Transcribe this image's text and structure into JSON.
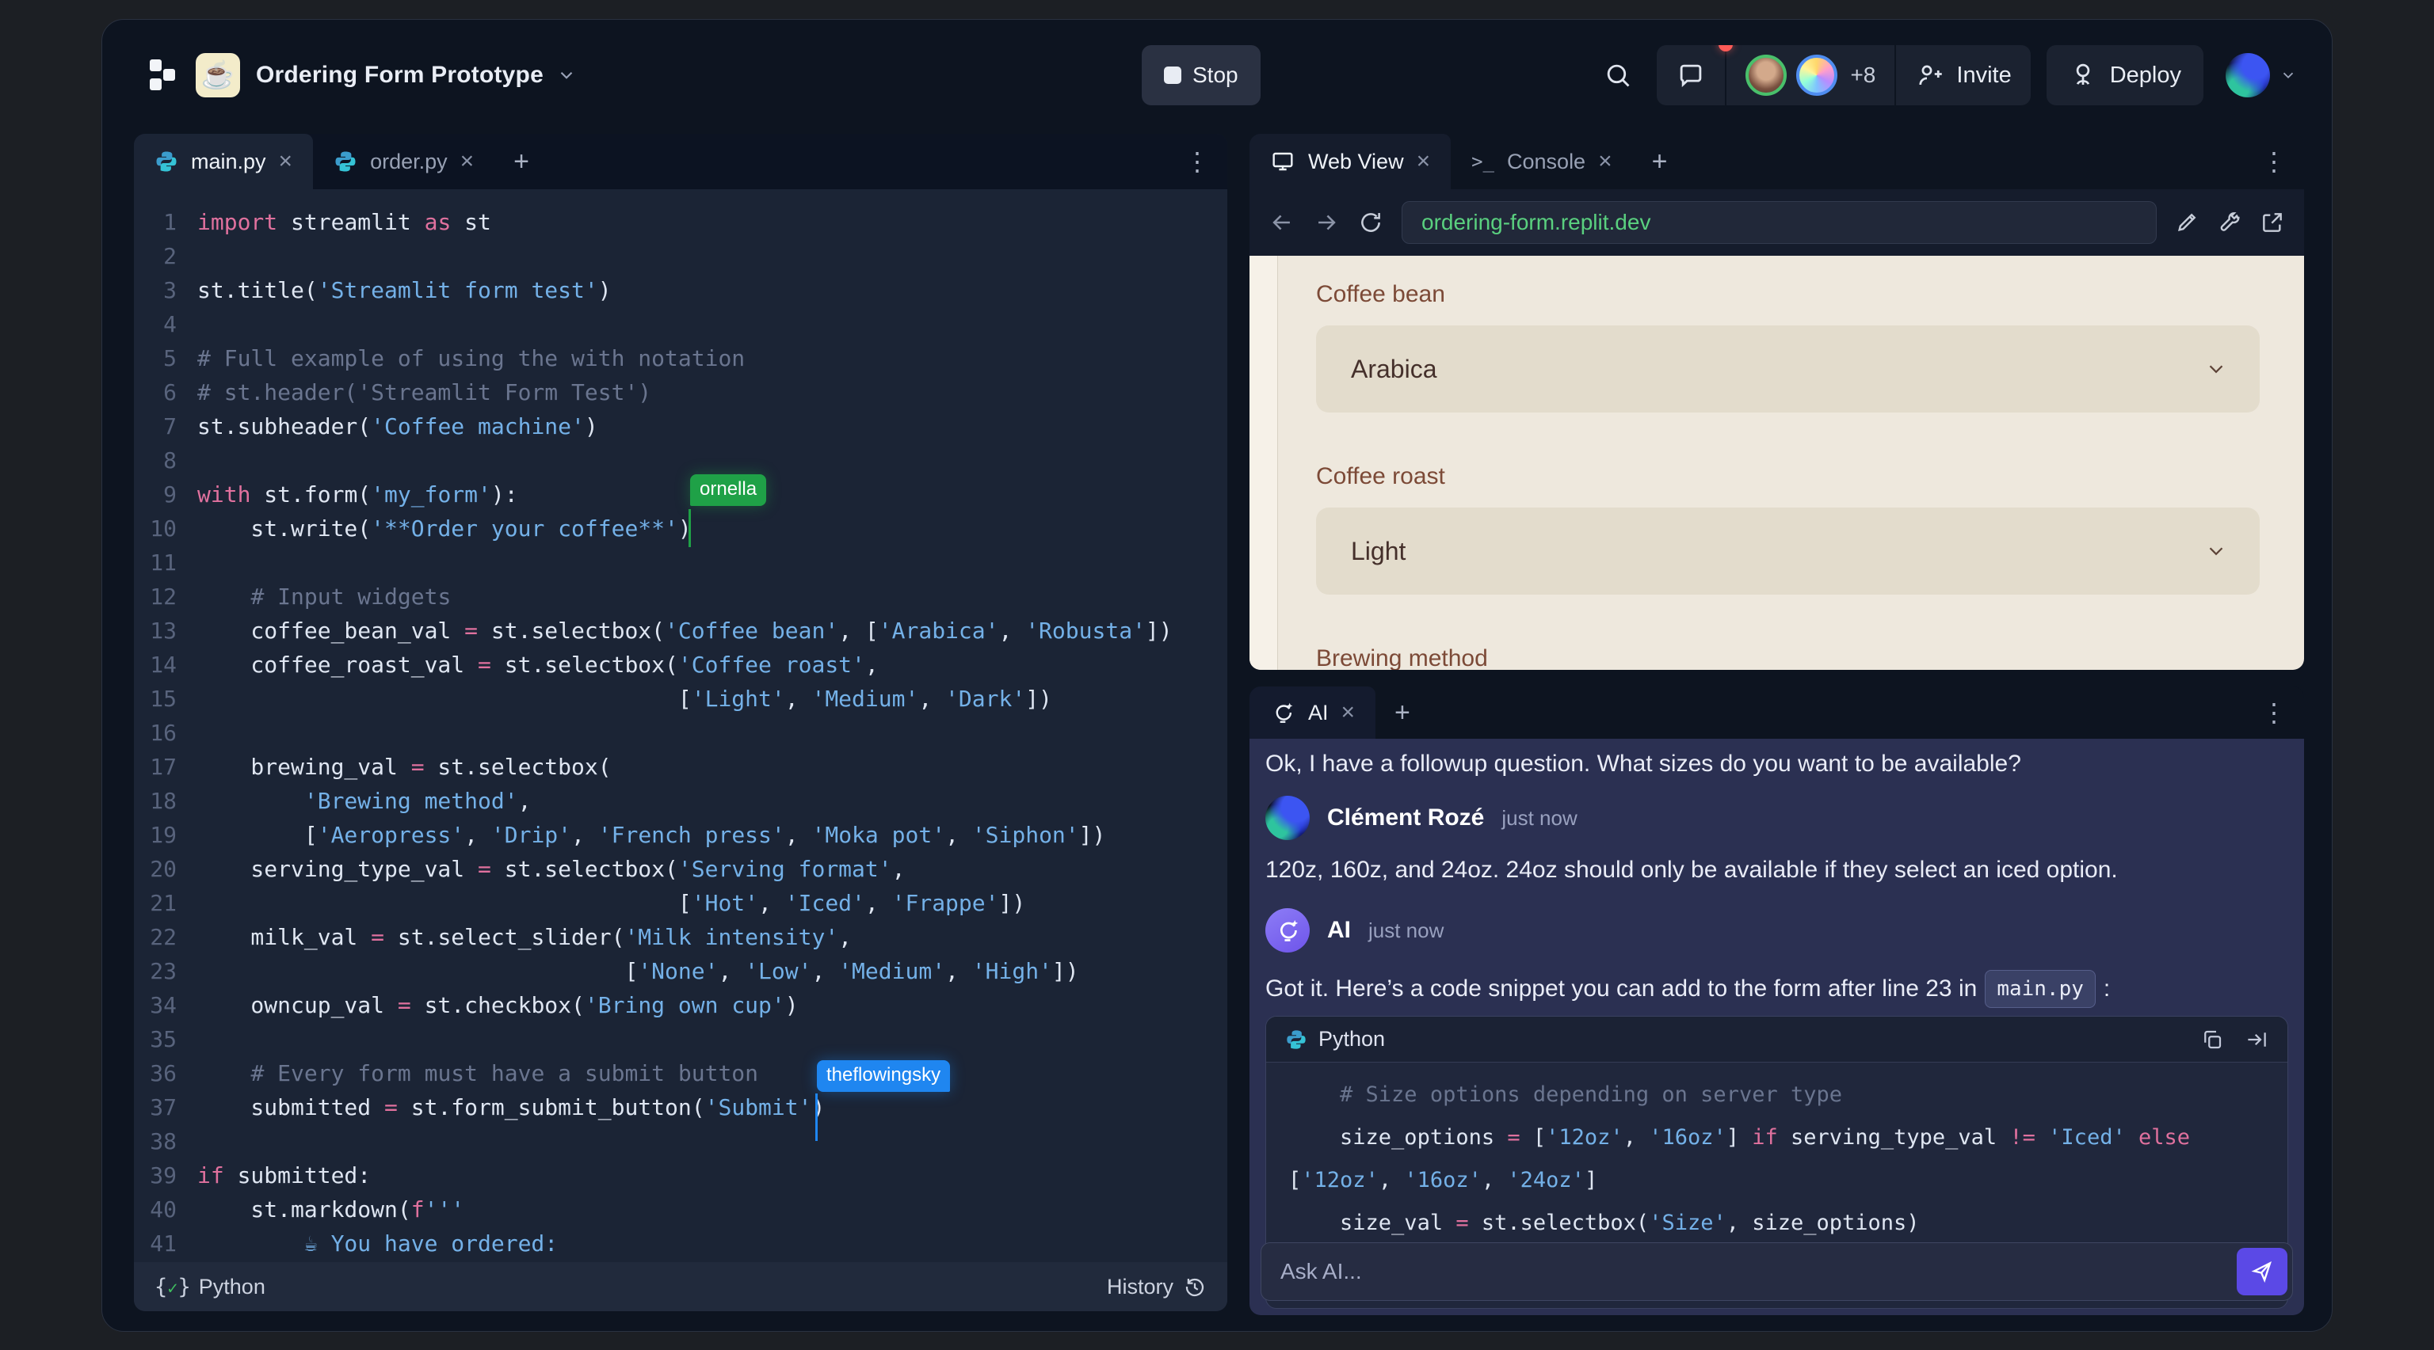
{
  "colors": {
    "window_bg": "#0d1420",
    "editor_bg": "#1b2435",
    "chat_bg": "#2b3052",
    "webview_bg": "#eee8dd",
    "url_green": "#5ad07f",
    "send_purple": "#5b49e6",
    "cursor_green": "#1fa147",
    "cursor_blue": "#1f86f0",
    "notification_red": "#ff5b57"
  },
  "icons": {
    "close": "×",
    "plus": "+",
    "kebab": "⋮",
    "console_glyph": ">_",
    "brace_open": "{",
    "check": "✓",
    "brace_close": "}",
    "coffee": "☕"
  },
  "topbar": {
    "title": "Ordering Form Prototype",
    "stop": "Stop",
    "members_more": "+8",
    "invite": "Invite",
    "deploy": "Deploy"
  },
  "editor": {
    "tabs": [
      {
        "label": "main.py"
      },
      {
        "label": "order.py"
      }
    ],
    "status": {
      "lang": "Python",
      "history": "History"
    },
    "cursors": {
      "green": "ornella",
      "blue": "theflowingsky"
    },
    "lines": [
      {
        "n": "1",
        "t": [
          [
            "k",
            "import"
          ],
          [
            "p",
            " streamlit "
          ],
          [
            "k",
            "as"
          ],
          [
            "p",
            " st"
          ]
        ]
      },
      {
        "n": "2",
        "t": []
      },
      {
        "n": "3",
        "t": [
          [
            "p",
            "st.title("
          ],
          [
            "s",
            "'Streamlit form test'"
          ],
          [
            "p",
            ")"
          ]
        ]
      },
      {
        "n": "4",
        "t": []
      },
      {
        "n": "5",
        "t": [
          [
            "c",
            "# Full example of using the with notation"
          ]
        ]
      },
      {
        "n": "6",
        "t": [
          [
            "c",
            "# st.header('Streamlit Form Test')"
          ]
        ]
      },
      {
        "n": "7",
        "t": [
          [
            "p",
            "st.subheader("
          ],
          [
            "s",
            "'Coffee machine'"
          ],
          [
            "p",
            ")"
          ]
        ]
      },
      {
        "n": "8",
        "t": []
      },
      {
        "n": "9",
        "t": [
          [
            "k",
            "with"
          ],
          [
            "p",
            " st.form("
          ],
          [
            "s",
            "'my_form'"
          ],
          [
            "p",
            "):"
          ]
        ]
      },
      {
        "n": "10",
        "t": [
          [
            "p",
            "    st.write("
          ],
          [
            "s",
            "'**Order your coffee**'"
          ],
          [
            "p",
            ")"
          ]
        ]
      },
      {
        "n": "11",
        "t": []
      },
      {
        "n": "12",
        "t": [
          [
            "p",
            "    "
          ],
          [
            "c",
            "# Input widgets"
          ]
        ]
      },
      {
        "n": "13",
        "t": [
          [
            "p",
            "    coffee_bean_val "
          ],
          [
            "o",
            "="
          ],
          [
            "p",
            " st.selectbox("
          ],
          [
            "s",
            "'Coffee bean'"
          ],
          [
            "p",
            ", ["
          ],
          [
            "s",
            "'Arabica'"
          ],
          [
            "p",
            ", "
          ],
          [
            "s",
            "'Robusta'"
          ],
          [
            "p",
            "])"
          ]
        ]
      },
      {
        "n": "14",
        "t": [
          [
            "p",
            "    coffee_roast_val "
          ],
          [
            "o",
            "="
          ],
          [
            "p",
            " st.selectbox("
          ],
          [
            "s",
            "'Coffee roast'"
          ],
          [
            "p",
            ","
          ]
        ]
      },
      {
        "n": "15",
        "t": [
          [
            "p",
            "                                    ["
          ],
          [
            "s",
            "'Light'"
          ],
          [
            "p",
            ", "
          ],
          [
            "s",
            "'Medium'"
          ],
          [
            "p",
            ", "
          ],
          [
            "s",
            "'Dark'"
          ],
          [
            "p",
            "])"
          ]
        ]
      },
      {
        "n": "16",
        "t": []
      },
      {
        "n": "17",
        "t": [
          [
            "p",
            "    brewing_val "
          ],
          [
            "o",
            "="
          ],
          [
            "p",
            " st.selectbox("
          ]
        ]
      },
      {
        "n": "18",
        "t": [
          [
            "p",
            "        "
          ],
          [
            "s",
            "'Brewing method'"
          ],
          [
            "p",
            ","
          ]
        ]
      },
      {
        "n": "19",
        "t": [
          [
            "p",
            "        ["
          ],
          [
            "s",
            "'Aeropress'"
          ],
          [
            "p",
            ", "
          ],
          [
            "s",
            "'Drip'"
          ],
          [
            "p",
            ", "
          ],
          [
            "s",
            "'French press'"
          ],
          [
            "p",
            ", "
          ],
          [
            "s",
            "'Moka pot'"
          ],
          [
            "p",
            ", "
          ],
          [
            "s",
            "'Siphon'"
          ],
          [
            "p",
            "])"
          ]
        ]
      },
      {
        "n": "20",
        "t": [
          [
            "p",
            "    serving_type_val "
          ],
          [
            "o",
            "="
          ],
          [
            "p",
            " st.selectbox("
          ],
          [
            "s",
            "'Serving format'"
          ],
          [
            "p",
            ","
          ]
        ]
      },
      {
        "n": "21",
        "t": [
          [
            "p",
            "                                    ["
          ],
          [
            "s",
            "'Hot'"
          ],
          [
            "p",
            ", "
          ],
          [
            "s",
            "'Iced'"
          ],
          [
            "p",
            ", "
          ],
          [
            "s",
            "'Frappe'"
          ],
          [
            "p",
            "])"
          ]
        ]
      },
      {
        "n": "22",
        "t": [
          [
            "p",
            "    milk_val "
          ],
          [
            "o",
            "="
          ],
          [
            "p",
            " st.select_slider("
          ],
          [
            "s",
            "'Milk intensity'"
          ],
          [
            "p",
            ","
          ]
        ]
      },
      {
        "n": "23",
        "t": [
          [
            "p",
            "                                ["
          ],
          [
            "s",
            "'None'"
          ],
          [
            "p",
            ", "
          ],
          [
            "s",
            "'Low'"
          ],
          [
            "p",
            ", "
          ],
          [
            "s",
            "'Medium'"
          ],
          [
            "p",
            ", "
          ],
          [
            "s",
            "'High'"
          ],
          [
            "p",
            "])"
          ]
        ]
      },
      {
        "n": "34",
        "t": [
          [
            "p",
            "    owncup_val "
          ],
          [
            "o",
            "="
          ],
          [
            "p",
            " st.checkbox("
          ],
          [
            "s",
            "'Bring own cup'"
          ],
          [
            "p",
            ")"
          ]
        ]
      },
      {
        "n": "35",
        "t": []
      },
      {
        "n": "36",
        "t": [
          [
            "p",
            "    "
          ],
          [
            "c",
            "# Every form must have a submit button"
          ]
        ]
      },
      {
        "n": "37",
        "t": [
          [
            "p",
            "    submitted "
          ],
          [
            "o",
            "="
          ],
          [
            "p",
            " st.form_submit_button("
          ],
          [
            "s",
            "'Submit'"
          ],
          [
            "p",
            ")"
          ]
        ]
      },
      {
        "n": "38",
        "t": []
      },
      {
        "n": "39",
        "t": [
          [
            "k",
            "if"
          ],
          [
            "p",
            " submitted:"
          ]
        ]
      },
      {
        "n": "40",
        "t": [
          [
            "p",
            "    st.markdown("
          ],
          [
            "k",
            "f"
          ],
          [
            "s",
            "'''"
          ]
        ]
      },
      {
        "n": "41",
        "t": [
          [
            "s",
            "        ☕ You have ordered:"
          ]
        ]
      }
    ]
  },
  "webview": {
    "tab": "Web View",
    "console_tab": "Console",
    "url": "ordering-form.replit.dev",
    "form": {
      "field1_label": "Coffee bean",
      "field1_value": "Arabica",
      "field2_label": "Coffee roast",
      "field2_value": "Light",
      "field3_label": "Brewing method"
    }
  },
  "ai": {
    "tab_label": "AI",
    "messages": {
      "cont": "Ok, I have a followup question. What sizes do you want to be available?",
      "user_name": "Clément Rozé",
      "user_time": "just now",
      "user_text": "120z, 160z, and 24oz. 24oz should only be available if they select an iced option.",
      "ai_name": "AI",
      "ai_time": "just now",
      "ai_before": "Got it. Here’s a code snippet you can add to the form after line 23 in",
      "ai_chip": "main.py",
      "ai_after": ":"
    },
    "code_block": {
      "lang": "Python",
      "lines": [
        {
          "t": [
            [
              "c",
              "    # Size options depending on server type"
            ]
          ]
        },
        {
          "t": [
            [
              "p",
              "    size_options "
            ],
            [
              "o",
              "="
            ],
            [
              "p",
              " ["
            ],
            [
              "s",
              "'12oz'"
            ],
            [
              "p",
              ", "
            ],
            [
              "s",
              "'16oz'"
            ],
            [
              "p",
              "] "
            ],
            [
              "k",
              "if"
            ],
            [
              "p",
              " serving_type_val "
            ],
            [
              "o",
              "!="
            ],
            [
              "p",
              " "
            ],
            [
              "s",
              "'Iced'"
            ],
            [
              "p",
              " "
            ],
            [
              "k",
              "else"
            ],
            [
              "p",
              " ["
            ],
            [
              "s",
              "'12oz'"
            ],
            [
              "p",
              ", "
            ],
            [
              "s",
              "'16oz'"
            ],
            [
              "p",
              ", "
            ],
            [
              "s",
              "'24oz'"
            ],
            [
              "p",
              "]"
            ]
          ]
        },
        {
          "t": [
            [
              "p",
              "    size_val "
            ],
            [
              "o",
              "="
            ],
            [
              "p",
              " st.selectbox("
            ],
            [
              "s",
              "'Size'"
            ],
            [
              "p",
              ", size_options)"
            ]
          ]
        }
      ]
    },
    "input_placeholder": "Ask AI..."
  }
}
